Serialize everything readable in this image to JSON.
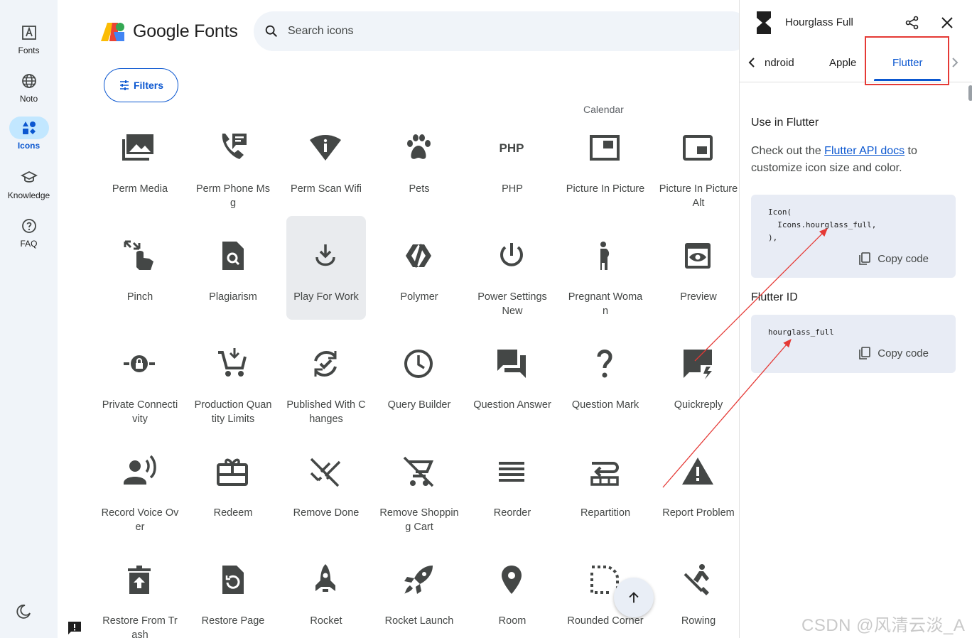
{
  "nav": {
    "items": [
      {
        "label": "Fonts",
        "icon": "font-icon"
      },
      {
        "label": "Noto",
        "icon": "globe-icon"
      },
      {
        "label": "Icons",
        "icon": "shapes-icon",
        "active": true
      },
      {
        "label": "Knowledge",
        "icon": "school-icon"
      },
      {
        "label": "FAQ",
        "icon": "help-icon"
      }
    ]
  },
  "header": {
    "brand": "Google Fonts",
    "search_placeholder": "Search icons",
    "filters_label": "Filters"
  },
  "grid": {
    "section_label": "Calendar",
    "icons": [
      {
        "label": "Perm Media",
        "icon": "perm-media"
      },
      {
        "label": "Perm Phone Msg",
        "icon": "perm-phone-msg"
      },
      {
        "label": "Perm Scan Wifi",
        "icon": "perm-scan-wifi"
      },
      {
        "label": "Pets",
        "icon": "pets"
      },
      {
        "label": "PHP",
        "icon": "php"
      },
      {
        "label": "Picture In Picture",
        "icon": "picture-in-picture"
      },
      {
        "label": "Picture In Picture Alt",
        "icon": "picture-in-picture-alt"
      },
      {
        "label": "Pinch",
        "icon": "pinch"
      },
      {
        "label": "Plagiarism",
        "icon": "plagiarism"
      },
      {
        "label": "Play For Work",
        "icon": "play-for-work"
      },
      {
        "label": "Polymer",
        "icon": "polymer"
      },
      {
        "label": "Power Settings New",
        "icon": "power-settings-new"
      },
      {
        "label": "Pregnant Woman",
        "icon": "pregnant-woman"
      },
      {
        "label": "Preview",
        "icon": "preview"
      },
      {
        "label": "Private Connectivity",
        "icon": "private-connectivity"
      },
      {
        "label": "Production Quantity Limits",
        "icon": "production-quantity-limits"
      },
      {
        "label": "Published With Changes",
        "icon": "published-with-changes"
      },
      {
        "label": "Query Builder",
        "icon": "query-builder"
      },
      {
        "label": "Question Answer",
        "icon": "question-answer"
      },
      {
        "label": "Question Mark",
        "icon": "question-mark"
      },
      {
        "label": "Quickreply",
        "icon": "quickreply"
      },
      {
        "label": "Record Voice Over",
        "icon": "record-voice-over"
      },
      {
        "label": "Redeem",
        "icon": "redeem"
      },
      {
        "label": "Remove Done",
        "icon": "remove-done"
      },
      {
        "label": "Remove Shopping Cart",
        "icon": "remove-shopping-cart"
      },
      {
        "label": "Reorder",
        "icon": "reorder"
      },
      {
        "label": "Repartition",
        "icon": "repartition"
      },
      {
        "label": "Report Problem",
        "icon": "report-problem"
      },
      {
        "label": "Restore From Trash",
        "icon": "restore-from-trash"
      },
      {
        "label": "Restore Page",
        "icon": "restore-page"
      },
      {
        "label": "Rocket",
        "icon": "rocket"
      },
      {
        "label": "Rocket Launch",
        "icon": "rocket-launch"
      },
      {
        "label": "Room",
        "icon": "room"
      },
      {
        "label": "Rounded Corner",
        "icon": "rounded-corner"
      },
      {
        "label": "Rowing",
        "icon": "rowing"
      }
    ]
  },
  "panel": {
    "title": "Hourglass Full",
    "tabs": [
      "ndroid",
      "Apple",
      "Flutter"
    ],
    "active_tab": "Flutter",
    "use_heading": "Use in Flutter",
    "desc_before": "Check out the ",
    "desc_link": "Flutter API docs",
    "desc_after": " to customize icon size and color.",
    "code_snippet": "Icon(\n  Icons.hourglass_full,\n),",
    "copy_label": "Copy code",
    "id_heading": "Flutter ID",
    "id_value": "hourglass_full",
    "copy_label_2": "Copy code"
  },
  "watermark": "CSDN @风清云淡_A",
  "colors": {
    "accent": "#0b57d0",
    "rail_bg": "#f0f4f9",
    "code_bg": "#e8ecf5",
    "annotation": "#e53935"
  }
}
